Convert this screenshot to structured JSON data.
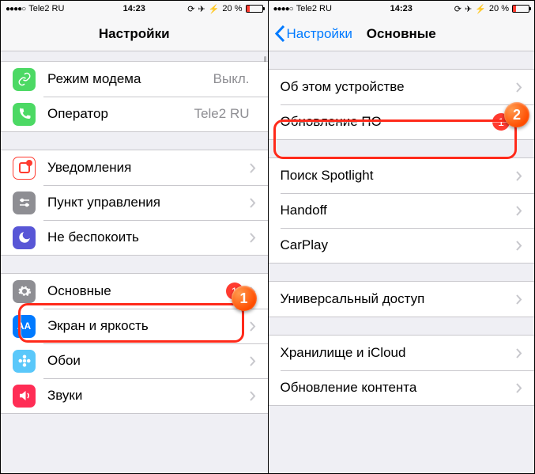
{
  "status": {
    "carrier": "Tele2 RU",
    "time": "14:23",
    "battery": "20 %"
  },
  "left": {
    "title": "Настройки",
    "group1": [
      {
        "label": "Режим модема",
        "value": "Выкл.",
        "icon": "link",
        "bg": "#4cd964"
      },
      {
        "label": "Оператор",
        "value": "Tele2 RU",
        "icon": "phone",
        "bg": "#4cd964"
      }
    ],
    "group2": [
      {
        "label": "Уведомления",
        "icon": "notif",
        "bg": "#ff3b30"
      },
      {
        "label": "Пункт управления",
        "icon": "cc",
        "bg": "#8e8e93"
      },
      {
        "label": "Не беспокоить",
        "icon": "moon",
        "bg": "#5856d6"
      }
    ],
    "group3": [
      {
        "label": "Основные",
        "icon": "gear",
        "bg": "#8e8e93",
        "badge": "1"
      },
      {
        "label": "Экран и яркость",
        "icon": "aa",
        "bg": "#007aff"
      },
      {
        "label": "Обои",
        "icon": "flower",
        "bg": "#5ac8fa"
      },
      {
        "label": "Звуки",
        "icon": "sound",
        "bg": "#ff2d55"
      }
    ],
    "callout": "1"
  },
  "right": {
    "back": "Настройки",
    "title": "Основные",
    "group1": [
      {
        "label": "Об этом устройстве"
      },
      {
        "label": "Обновление ПО",
        "badge": "1"
      }
    ],
    "group2": [
      {
        "label": "Поиск Spotlight"
      },
      {
        "label": "Handoff"
      },
      {
        "label": "CarPlay"
      }
    ],
    "group3": [
      {
        "label": "Универсальный доступ"
      }
    ],
    "group4": [
      {
        "label": "Хранилище и iCloud"
      },
      {
        "label": "Обновление контента"
      }
    ],
    "callout": "2"
  }
}
